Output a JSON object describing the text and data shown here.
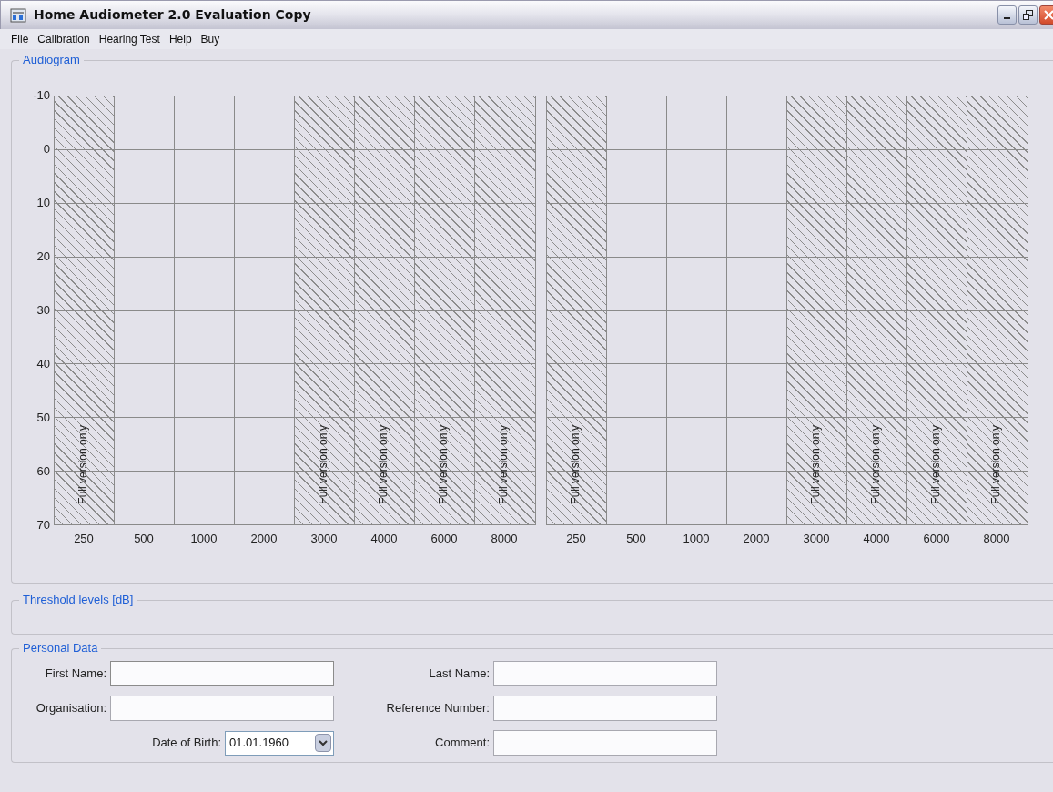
{
  "window": {
    "title": "Home Audiometer 2.0 Evaluation Copy"
  },
  "menu": [
    "File",
    "Calibration",
    "Hearing Test",
    "Help",
    "Buy"
  ],
  "audiogram": {
    "title": "Audiogram",
    "panels": [
      {
        "y_ticks": [
          "-10",
          "0",
          "10",
          "20",
          "30",
          "40",
          "50",
          "60",
          "70"
        ],
        "columns": [
          {
            "label": "250",
            "restricted": true,
            "note": "Full version only"
          },
          {
            "label": "500",
            "restricted": false
          },
          {
            "label": "1000",
            "restricted": false
          },
          {
            "label": "2000",
            "restricted": false
          },
          {
            "label": "3000",
            "restricted": true,
            "note": "Full version only"
          },
          {
            "label": "4000",
            "restricted": true,
            "note": "Full version only"
          },
          {
            "label": "6000",
            "restricted": true,
            "note": "Full version only"
          },
          {
            "label": "8000",
            "restricted": true,
            "note": "Full version only"
          }
        ]
      },
      {
        "columns": [
          {
            "label": "250",
            "restricted": true,
            "note": "Full version only"
          },
          {
            "label": "500",
            "restricted": false
          },
          {
            "label": "1000",
            "restricted": false
          },
          {
            "label": "2000",
            "restricted": false
          },
          {
            "label": "3000",
            "restricted": true,
            "note": "Full version only"
          },
          {
            "label": "4000",
            "restricted": true,
            "note": "Full version only"
          },
          {
            "label": "6000",
            "restricted": true,
            "note": "Full version only"
          },
          {
            "label": "8000",
            "restricted": true,
            "note": "Full version only"
          }
        ]
      }
    ]
  },
  "threshold_levels": {
    "title": "Threshold levels [dB]"
  },
  "personal_data": {
    "title": "Personal Data",
    "columns": [
      [
        {
          "label": "First Name:",
          "kind": "text",
          "focused": true
        },
        {
          "label": "Organisation:",
          "kind": "text",
          "focused": false
        },
        {
          "label": "Date of Birth:",
          "kind": "dropdown",
          "value": "01.01.1960",
          "focused": false
        }
      ],
      [
        {
          "label": "Last Name:",
          "kind": "text",
          "focused": false
        },
        {
          "label": "Reference Number:",
          "kind": "text",
          "focused": false
        },
        {
          "label": "Comment:",
          "kind": "text",
          "focused": false
        }
      ]
    ]
  }
}
